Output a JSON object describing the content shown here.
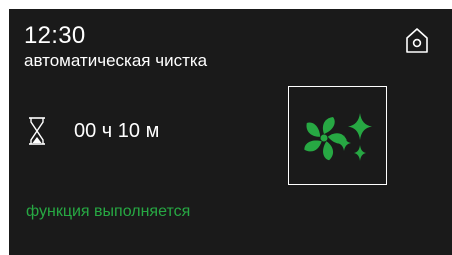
{
  "header": {
    "time": "12:30",
    "program_name": "автоматическая чистка",
    "home_icon": "home-icon"
  },
  "timer": {
    "icon": "hourglass-icon",
    "value": "00 ч 10 м"
  },
  "function_tile": {
    "icon": "fan-sparkle-cleaning-icon",
    "icon_color": "#27a843"
  },
  "status": {
    "text": "функция выполняется",
    "color": "#27a843"
  },
  "colors": {
    "background": "#1a1a1a",
    "text": "#ffffff",
    "accent": "#27a843"
  }
}
